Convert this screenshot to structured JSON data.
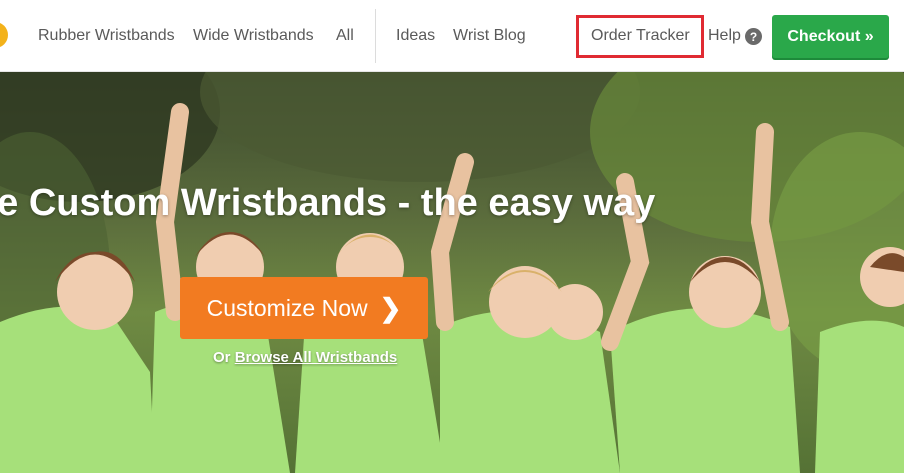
{
  "nav": {
    "links_left": [
      "Rubber Wristbands",
      "Wide Wristbands",
      "All"
    ],
    "links_mid": [
      "Ideas",
      "Wrist Blog"
    ],
    "order_tracker": "Order Tracker",
    "help": "Help",
    "help_icon": "?",
    "checkout": "Checkout »"
  },
  "hero": {
    "title": "ke Custom Wristbands - the easy way",
    "cta": "Customize Now",
    "cta_icon": "❯",
    "browse_prefix": "Or",
    "browse_link": "Browse All Wristbands"
  },
  "colors": {
    "checkout_green": "#2aa84a",
    "cta_orange": "#f27b21",
    "highlight_red": "#e02a32",
    "shirt_green": "#a6e07a"
  }
}
